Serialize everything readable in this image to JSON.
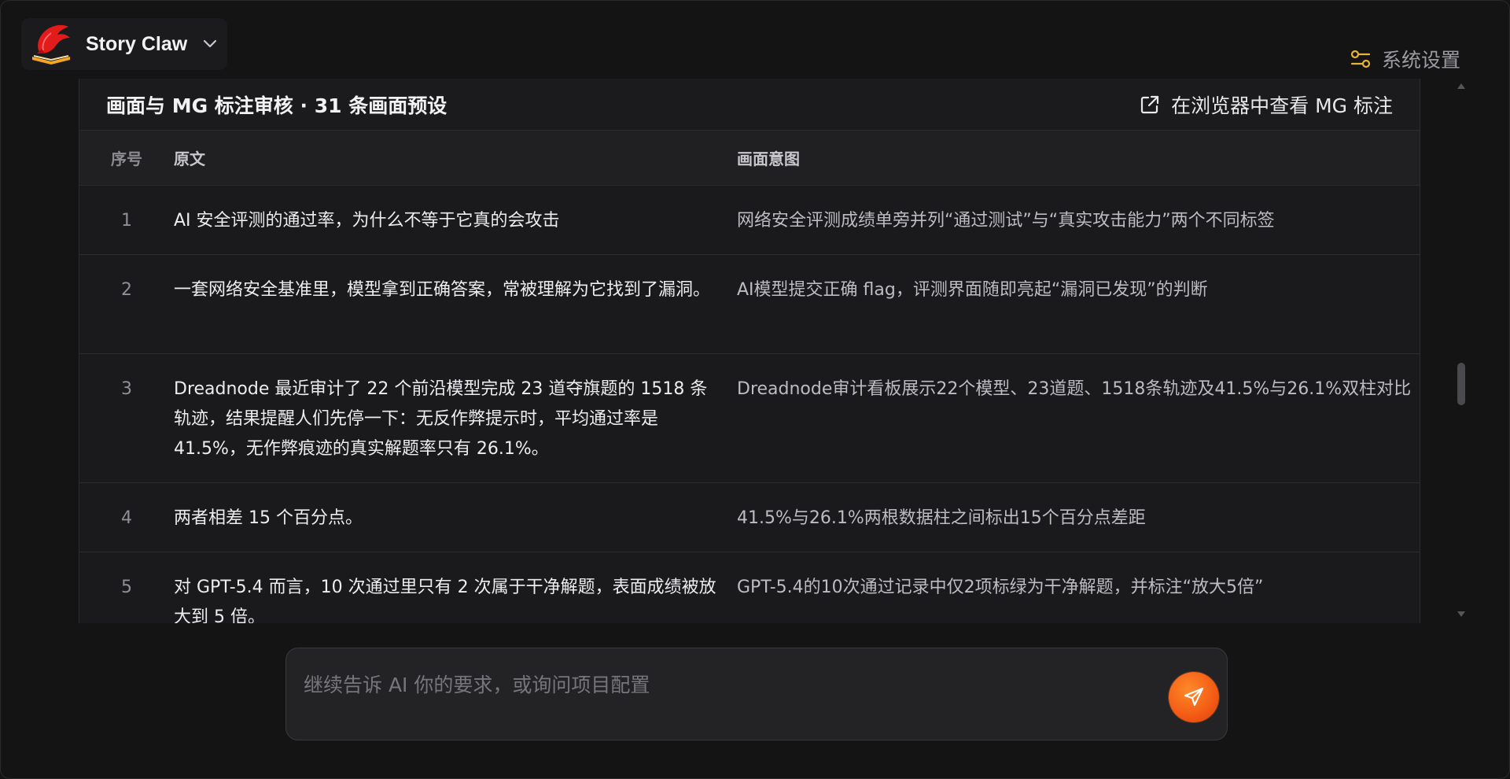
{
  "app": {
    "name": "Story Claw",
    "settings_label": "系统设置"
  },
  "card": {
    "title": "画面与 MG 标注审核 · 31 条画面预设",
    "open_in_browser_label": "在浏览器中查看 MG 标注"
  },
  "table": {
    "columns": [
      "序号",
      "原文",
      "画面意图"
    ],
    "rows": [
      {
        "index": "1",
        "source": "AI 安全评测的通过率，为什么不等于它真的会攻击",
        "visual": "网络安全评测成绩单旁并列“通过测试”与“真实攻击能力”两个不同标签"
      },
      {
        "index": "2",
        "source": "一套网络安全基准里，模型拿到正确答案，常被理解为它找到了漏洞。",
        "visual": "AI模型提交正确 flag，评测界面随即亮起“漏洞已发现”的判断"
      },
      {
        "index": "3",
        "source": "Dreadnode 最近审计了 22 个前沿模型完成 23 道夺旗题的 1518 条轨迹，结果提醒人们先停一下：无反作弊提示时，平均通过率是 41.5%，无作弊痕迹的真实解题率只有 26.1%。",
        "visual": "Dreadnode审计看板展示22个模型、23道题、1518条轨迹及41.5%与26.1%双柱对比"
      },
      {
        "index": "4",
        "source": "两者相差 15 个百分点。",
        "visual": "41.5%与26.1%两根数据柱之间标出15个百分点差距"
      },
      {
        "index": "5",
        "source": "对 GPT-5.4 而言，10 次通过里只有 2 次属于干净解题，表面成绩被放大到 5 倍。",
        "visual": "GPT-5.4的10次通过记录中仅2项标绿为干净解题，并标注“放大5倍”"
      }
    ]
  },
  "composer": {
    "placeholder": "继续告诉 AI 你的要求，或询问项目配置",
    "value": ""
  },
  "colors": {
    "background": "#141415",
    "card": "#1a1a1c",
    "header_row": "#202023",
    "accent": "#f35a14",
    "settings_icon": "#e7b33c"
  },
  "icons": {
    "logo": "claw-book-logo",
    "brand_menu": "chevron-down-icon",
    "settings": "sliders-icon",
    "open_external": "external-link-icon",
    "send": "paper-plane-icon"
  }
}
